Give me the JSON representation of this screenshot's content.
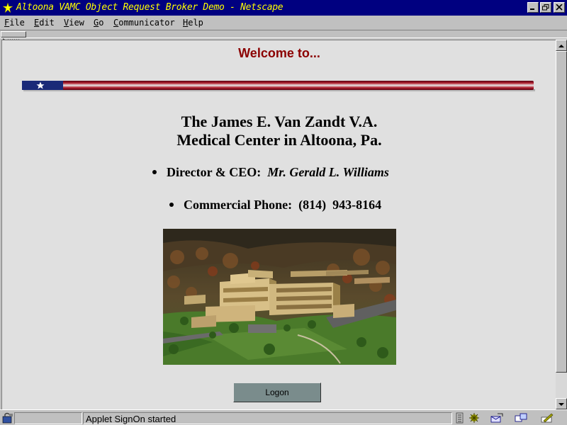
{
  "window": {
    "title": "Altoona VAMC Object Request Broker Demo - Netscape"
  },
  "menu": {
    "items": [
      {
        "label": "File",
        "key": "F"
      },
      {
        "label": "Edit",
        "key": "E"
      },
      {
        "label": "View",
        "key": "V"
      },
      {
        "label": "Go",
        "key": "G"
      },
      {
        "label": "Communicator",
        "key": "C"
      },
      {
        "label": "Help",
        "key": "H"
      }
    ]
  },
  "page": {
    "welcome": "Welcome to...",
    "heading_line1": "The James E. Van Zandt V.A.",
    "heading_line2": "Medical Center in Altoona, Pa.",
    "director_label": "Director & CEO:",
    "director_name": "Mr. Gerald L. Williams",
    "phone_label": "Commercial Phone:",
    "phone_value": "(814)  943-8164",
    "logon_label": "Logon"
  },
  "status": {
    "text": "Applet SignOn started"
  },
  "colors": {
    "welcome": "#8b0000",
    "titlebar": "#000080",
    "title_text": "#ffff00",
    "logon_button": "#7a8c8c"
  }
}
